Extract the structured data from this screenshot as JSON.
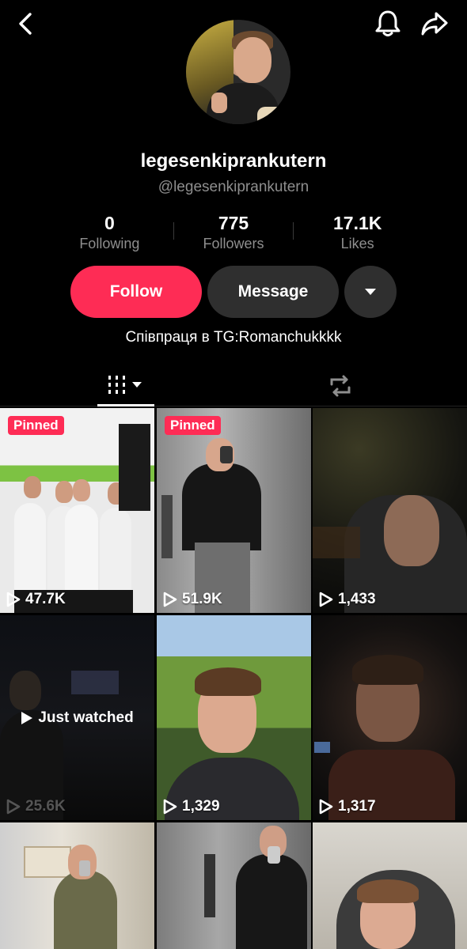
{
  "profile": {
    "display_name": "legesenkiprankutern",
    "handle": "@legesenkiprankutern",
    "bio": "Співпраця в TG:Romanchukkkk"
  },
  "stats": [
    {
      "value": "0",
      "label": "Following"
    },
    {
      "value": "775",
      "label": "Followers"
    },
    {
      "value": "17.1K",
      "label": "Likes"
    }
  ],
  "actions": {
    "follow_label": "Follow",
    "message_label": "Message"
  },
  "colors": {
    "accent": "#fe2c55",
    "secondary_button": "#2f2f2f",
    "muted_text": "#8e8e8e"
  },
  "icons": [
    "back-icon",
    "bell-icon",
    "share-icon",
    "chevron-down-icon",
    "videos-grid-icon",
    "repost-icon",
    "play-icon"
  ],
  "videos": [
    {
      "pinned_label": "Pinned",
      "views": "47.7K"
    },
    {
      "pinned_label": "Pinned",
      "views": "51.9K"
    },
    {
      "views": "1,433"
    },
    {
      "views": "25.6K",
      "overlay": "Just watched"
    },
    {
      "views": "1,329"
    },
    {
      "views": "1,317"
    },
    {},
    {},
    {}
  ]
}
